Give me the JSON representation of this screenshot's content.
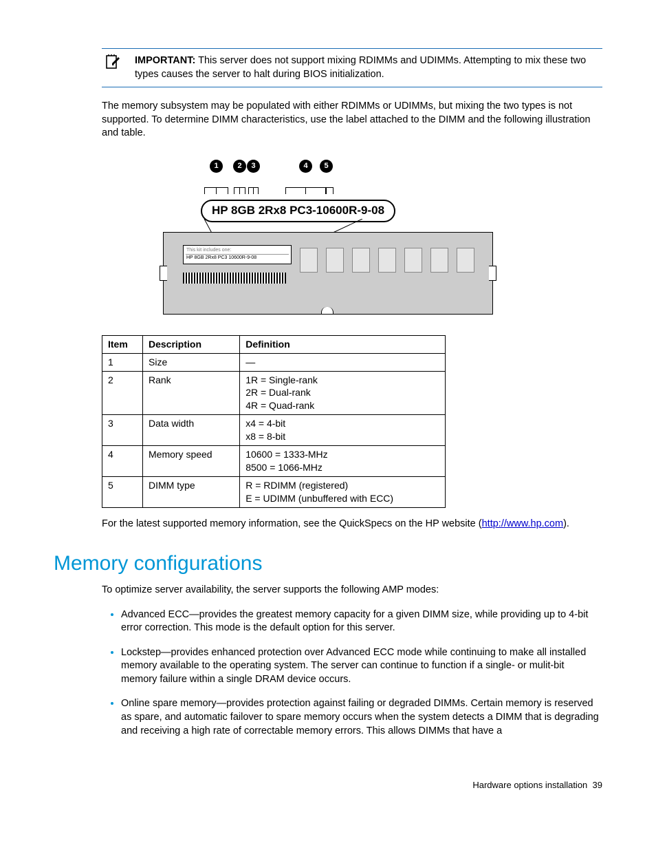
{
  "important": {
    "label": "IMPORTANT:",
    "text": "This server does not support mixing RDIMMs and UDIMMs. Attempting to mix these two types causes the server to halt during BIOS initialization."
  },
  "intro_paragraph": "The memory subsystem may be populated with either RDIMMs or UDIMMs, but mixing the two types is not supported. To determine DIMM characteristics, use the label attached to the DIMM and the following illustration and table.",
  "figure": {
    "label_text": "HP 8GB 2Rx8 PC3-10600R-9-08",
    "small_label_line1": "This kit includes one:",
    "small_label_line2": "HP 8GB 2Rx8 PC3 10600R-9-08",
    "callouts": [
      "1",
      "2",
      "3",
      "4",
      "5"
    ]
  },
  "table": {
    "headers": [
      "Item",
      "Description",
      "Definition"
    ],
    "rows": [
      {
        "item": "1",
        "desc": "Size",
        "def": "—"
      },
      {
        "item": "2",
        "desc": "Rank",
        "def": "1R = Single-rank\n2R = Dual-rank\n4R = Quad-rank"
      },
      {
        "item": "3",
        "desc": "Data width",
        "def": "x4 = 4-bit\nx8 = 8-bit"
      },
      {
        "item": "4",
        "desc": "Memory speed",
        "def": "10600 = 1333-MHz\n8500 = 1066-MHz"
      },
      {
        "item": "5",
        "desc": "DIMM type",
        "def": "R = RDIMM (registered)\nE = UDIMM (unbuffered with ECC)"
      }
    ]
  },
  "quickspecs": {
    "prefix": "For the latest supported memory information, see the QuickSpecs on the HP website (",
    "link_text": "http://www.hp.com",
    "suffix": ")."
  },
  "section_heading": "Memory configurations",
  "section_intro": "To optimize server availability, the server supports the following AMP modes:",
  "bullets": [
    "Advanced ECC—provides the greatest memory capacity for a given DIMM size, while providing up to 4-bit error correction.  This mode is the default option for this server.",
    "Lockstep—provides enhanced protection over Advanced ECC mode while continuing to make all installed memory available to the operating system. The server can continue to function if a single- or mulit-bit memory failure within a single DRAM device occurs.",
    "Online spare memory—provides protection against failing or degraded DIMMs. Certain memory is reserved as spare, and automatic failover to spare memory occurs when the system detects a DIMM that is degrading and receiving a high rate of correctable memory errors. This allows DIMMs that have a"
  ],
  "footer": {
    "section": "Hardware options installation",
    "page": "39"
  }
}
